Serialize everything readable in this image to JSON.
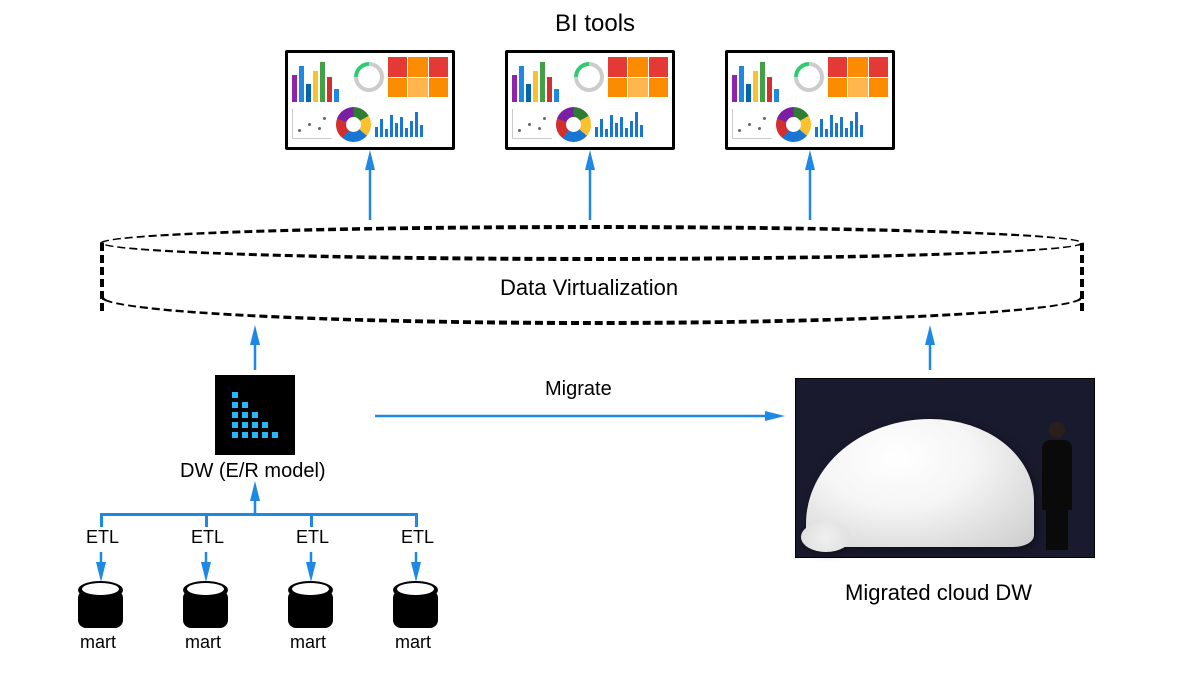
{
  "labels": {
    "bi_tools": "BI tools",
    "data_virt": "Data Virtualization",
    "dw_er": "DW (E/R model)",
    "migrate": "Migrate",
    "migrated_cloud": "Migrated cloud DW",
    "etl": "ETL",
    "mart": "mart"
  },
  "arrows": {
    "color": "#1e88e5"
  },
  "diagram": {
    "nodes": [
      {
        "id": "bi-dashboards",
        "count": 3,
        "role": "consumer"
      },
      {
        "id": "data-virtualization",
        "role": "layer"
      },
      {
        "id": "dw-er-model",
        "role": "source",
        "feeds": [
          "data-virtualization"
        ],
        "migrates_to": "migrated-cloud-dw"
      },
      {
        "id": "migrated-cloud-dw",
        "role": "target",
        "feeds": [
          "data-virtualization"
        ]
      },
      {
        "id": "marts",
        "count": 4,
        "via": "ETL",
        "from": "dw-er-model"
      }
    ]
  }
}
